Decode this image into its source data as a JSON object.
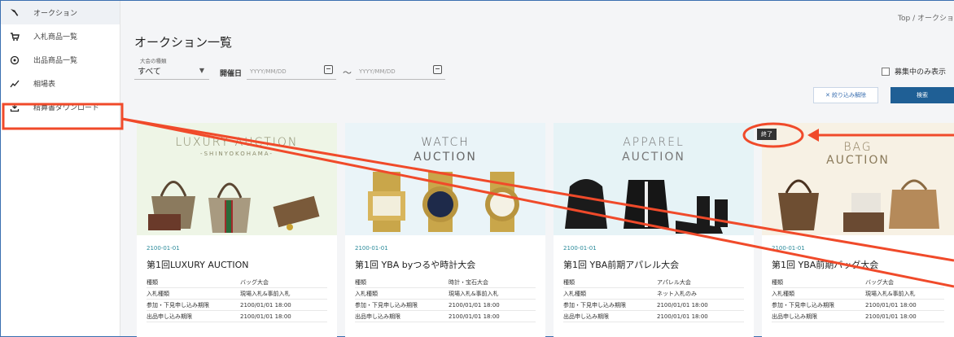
{
  "sidebar": {
    "items": [
      {
        "label": "オークション",
        "icon": "gavel-icon"
      },
      {
        "label": "入札商品一覧",
        "icon": "cart-icon"
      },
      {
        "label": "出品商品一覧",
        "icon": "tag-icon"
      },
      {
        "label": "相場表",
        "icon": "chart-icon"
      },
      {
        "label": "精算書ダウンロード",
        "icon": "download-icon"
      }
    ]
  },
  "header": {
    "breadcrumb": "Top / オークショ",
    "title": "オークション一覧"
  },
  "filters": {
    "type_label": "大会の種類",
    "type_value": "すべて",
    "date_label": "開催日",
    "date_from_placeholder": "YYYY/MM/DD",
    "date_to_placeholder": "YYYY/MM/DD",
    "tilde": "〜",
    "recruiting_only": "募集中のみ表示",
    "clear_button": "✕ 絞り込み解除",
    "search_button": "検索"
  },
  "status_badge": "終了",
  "cards": [
    {
      "banner1": "LUXURY AUCTION",
      "banner2": "-SHINYOKOHAMA-",
      "bg": "#eef5e6",
      "date": "2100-01-01",
      "title": "第1回LUXURY AUCTION",
      "rows": [
        {
          "k": "種類",
          "v": "バッグ大会"
        },
        {
          "k": "入札種類",
          "v": "現場入札&事前入札"
        },
        {
          "k": "参加・下見申し込み期限",
          "v": "2100/01/01 18:00"
        },
        {
          "k": "出品申し込み期限",
          "v": "2100/01/01 18:00"
        }
      ]
    },
    {
      "banner1": "WATCH",
      "banner2": "AUCTION",
      "bg": "#eaf4f8",
      "date": "2100-01-01",
      "title": "第1回 YBA byつるや時計大会",
      "rows": [
        {
          "k": "種類",
          "v": "時計・宝石大会"
        },
        {
          "k": "入札種類",
          "v": "現場入札&事前入札"
        },
        {
          "k": "参加・下見申し込み期限",
          "v": "2100/01/01 18:00"
        },
        {
          "k": "出品申し込み期限",
          "v": "2100/01/01 18:00"
        }
      ]
    },
    {
      "banner1": "APPAREL",
      "banner2": "AUCTION",
      "bg": "#e6f3f6",
      "date": "2100-01-01",
      "title": "第1回 YBA前期アパレル大会",
      "rows": [
        {
          "k": "種類",
          "v": "アパレル大会"
        },
        {
          "k": "入札種類",
          "v": "ネット入札のみ"
        },
        {
          "k": "参加・下見申し込み期限",
          "v": "2100/01/01 18:00"
        },
        {
          "k": "出品申し込み期限",
          "v": "2100/01/01 18:00"
        }
      ]
    },
    {
      "banner1": "BAG",
      "banner2": "AUCTION",
      "bg": "#f7f1e4",
      "date": "2100-01-01",
      "title": "第1回 YBA前期バッグ大会",
      "rows": [
        {
          "k": "種類",
          "v": "バッグ大会"
        },
        {
          "k": "入札種類",
          "v": "現場入札&事前入札"
        },
        {
          "k": "参加・下見申し込み期限",
          "v": "2100/01/01 18:00"
        },
        {
          "k": "出品申し込み期限",
          "v": "2100/01/01 18:00"
        }
      ]
    }
  ],
  "colors": {
    "accent": "#1f5f95",
    "annotation": "#f04a2a"
  }
}
